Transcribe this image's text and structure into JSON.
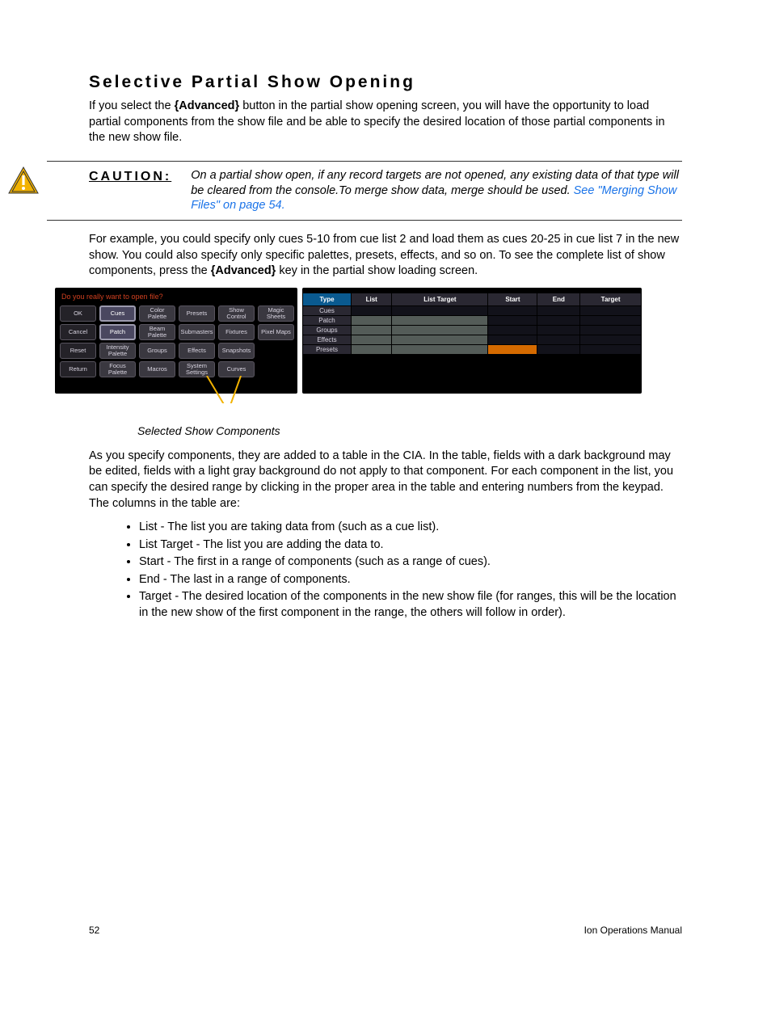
{
  "heading": "Selective Partial Show Opening",
  "para1_a": "If you select the ",
  "para1_key": "{Advanced}",
  "para1_b": " button in the partial show opening screen, you will have the opportunity to load partial components from the show file and be able to specify the desired location of those partial components in the new show file.",
  "caution": {
    "label": "CAUTION:",
    "text_a": "On a partial show open, if any record targets are not opened, any existing data of that type will be cleared from the console.To merge show data, merge should be used. ",
    "link": "See \"Merging Show Files\" on page 54."
  },
  "para2_a": "For example, you could specify only cues 5-10 from cue list 2 and load them as cues 20-25 in cue list 7 in the new show. You could also specify only specific palettes, presets, effects, and so on. To see the complete list of show components, press the ",
  "para2_key": "{Advanced}",
  "para2_b": " key in the partial show loading screen.",
  "figure": {
    "prompt": "Do you really want to open file?",
    "action_buttons": [
      "OK",
      "Cancel",
      "Reset",
      "Return"
    ],
    "grid_rows": [
      [
        "Cues",
        "Color Palette",
        "Presets",
        "Show Control",
        "Magic Sheets"
      ],
      [
        "Patch",
        "Beam Palette",
        "Submasters",
        "Fixtures",
        "Pixel Maps"
      ],
      [
        "Intensity Palette",
        "Groups",
        "Effects",
        "Snapshots",
        ""
      ],
      [
        "Focus Palette",
        "Macros",
        "System Settings",
        "Curves",
        ""
      ]
    ],
    "selected_cells": [
      "Cues",
      "Patch"
    ],
    "table_headers": [
      "Type",
      "List",
      "List Target",
      "Start",
      "End",
      "Target"
    ],
    "table_rows": [
      "Cues",
      "Patch",
      "Groups",
      "Effects",
      "Presets"
    ]
  },
  "callout_caption": "Selected Show Components",
  "para3": "As you specify components, they are added to a table in the CIA. In the table, fields with a dark background may be edited, fields with a light gray background do not apply to that component. For each component in the list, you can specify the desired range by clicking in the proper area in the table and entering numbers from the keypad. The columns in the table are:",
  "columns": [
    "List - The list you are taking data from (such as a cue list).",
    "List Target - The list you are adding the data to.",
    "Start - The first in a range of components (such as a range of cues).",
    "End - The last in a range of components.",
    "Target - The desired location of the components in the new show file (for ranges, this will be the location in the new show of the first component in the range, the others will follow in order)."
  ],
  "footer": {
    "page": "52",
    "doc": "Ion Operations Manual"
  }
}
